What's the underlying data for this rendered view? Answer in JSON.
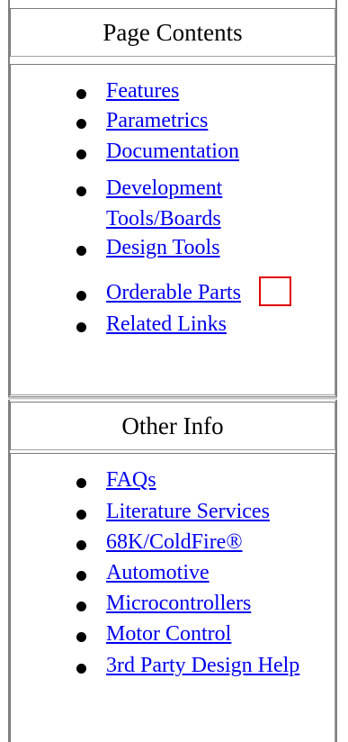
{
  "contents": {
    "title": "Page Contents",
    "items": [
      {
        "label": "Features"
      },
      {
        "label": "Parametrics"
      },
      {
        "label": "Documentation"
      },
      {
        "label": "Development"
      },
      {
        "label": "Tools/Boards"
      },
      {
        "label": "Design Tools"
      },
      {
        "label": "Orderable Parts"
      },
      {
        "label": "Related Links"
      }
    ]
  },
  "other": {
    "title": "Other Info",
    "items": [
      {
        "label": "FAQs"
      },
      {
        "label": "Literature Services"
      },
      {
        "label": "68K/ColdFire®"
      },
      {
        "label": "Automotive"
      },
      {
        "label": "Microcontrollers"
      },
      {
        "label": "Motor Control"
      },
      {
        "label": "3rd Party Design Help"
      }
    ]
  },
  "colors": {
    "link": "#0000ee",
    "highlight_box": "#e00000",
    "border": "#808080"
  }
}
